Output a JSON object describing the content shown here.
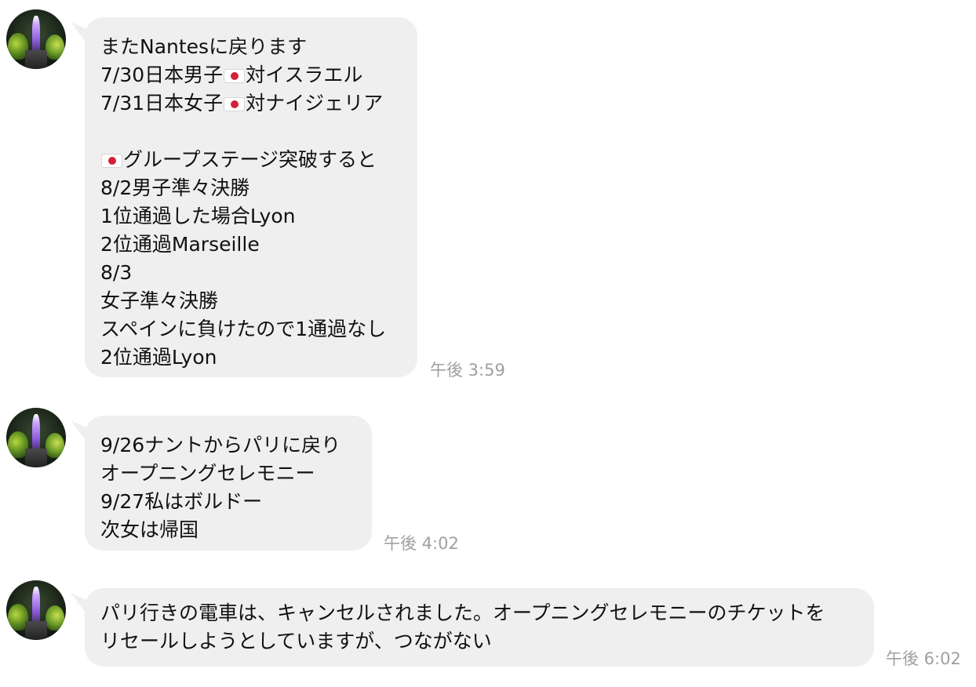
{
  "messages": [
    {
      "lines": [
        [
          "またNantesに戻ります"
        ],
        [
          "7/30日本男子",
          "flag",
          "対イスラエル"
        ],
        [
          "7/31日本女子",
          "flag",
          "対ナイジェリア"
        ],
        [
          ""
        ],
        [
          "flag",
          "グループステージ突破すると"
        ],
        [
          "8/2男子準々決勝"
        ],
        [
          "1位通過した場合Lyon"
        ],
        [
          "2位通過Marseille"
        ],
        [
          "8/3"
        ],
        [
          "女子準々決勝"
        ],
        [
          "スペインに負けたので1通過なし"
        ],
        [
          "2位通過Lyon"
        ]
      ],
      "time": "午後 3:59"
    },
    {
      "lines": [
        [
          "9/26ナントからパリに戻り"
        ],
        [
          "オープニングセレモニー"
        ],
        [
          "9/27私はボルドー"
        ],
        [
          "次女は帰国"
        ]
      ],
      "time": "午後 4:02"
    },
    {
      "lines": [
        [
          "パリ行きの電車は、キャンセルされました。オープニングセレモニーのチケットを"
        ],
        [
          "リセールしようとしていますが、つながない"
        ]
      ],
      "time": "午後 6:02"
    }
  ],
  "icons": {
    "avatar": "avatar-photo",
    "flag": "japan-flag-icon"
  },
  "colors": {
    "bubble": "#efefef",
    "text": "#111111",
    "time": "#a0a0a0",
    "flag_red": "#d5203a"
  }
}
